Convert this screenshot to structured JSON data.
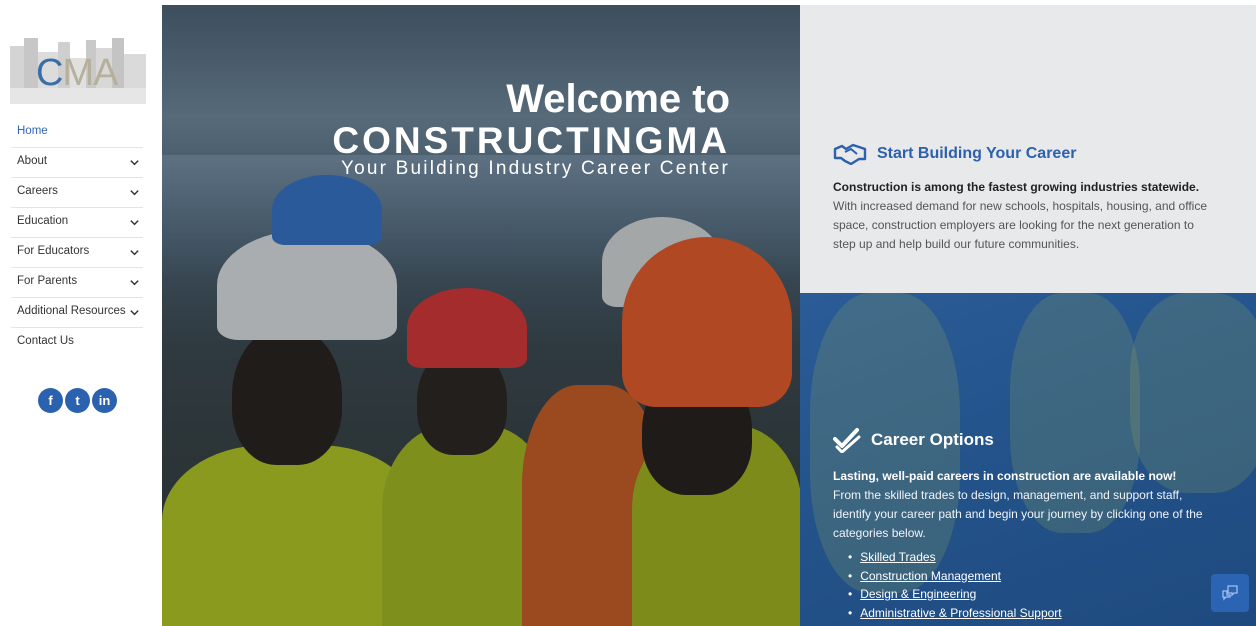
{
  "logo": {
    "part1": "C",
    "part2": "MA"
  },
  "nav": [
    {
      "label": "Home",
      "active": true,
      "has_submenu": false
    },
    {
      "label": "About",
      "active": false,
      "has_submenu": true
    },
    {
      "label": "Careers",
      "active": false,
      "has_submenu": true
    },
    {
      "label": "Education",
      "active": false,
      "has_submenu": true
    },
    {
      "label": "For Educators",
      "active": false,
      "has_submenu": true
    },
    {
      "label": "For Parents",
      "active": false,
      "has_submenu": true
    },
    {
      "label": "Additional Resources",
      "active": false,
      "has_submenu": true
    },
    {
      "label": "Contact Us",
      "active": false,
      "has_submenu": false
    }
  ],
  "social": [
    {
      "label": "f",
      "icon": "facebook-icon"
    },
    {
      "label": "t",
      "icon": "twitter-icon"
    },
    {
      "label": "in",
      "icon": "linkedin-icon"
    }
  ],
  "hero": {
    "line1": "Welcome to",
    "line2": "CONSTRUCTINGMA",
    "line3": "Your Building Industry Career Center"
  },
  "start_building": {
    "heading": "Start Building Your Career",
    "icon": "handshake-icon",
    "lead": "Construction is among the fastest growing industries statewide.",
    "text": "With increased demand for new schools, hospitals, housing, and office space, construction employers are looking for the next generation to step up and help build our future communities."
  },
  "career_options": {
    "heading": "Career Options",
    "icon": "double-check-icon",
    "lead": "Lasting, well-paid careers in construction are available now!",
    "text": "From the skilled trades to design, management, and support staff, identify your career path and begin your journey by clicking one of the categories below.",
    "links": [
      "Skilled Trades",
      "Construction Management",
      "Design & Engineering",
      "Administrative & Professional Support"
    ]
  },
  "colors": {
    "brand_blue": "#2d60ad",
    "panel_blue": "#24548c",
    "panel_gray": "#e8e9ea"
  }
}
